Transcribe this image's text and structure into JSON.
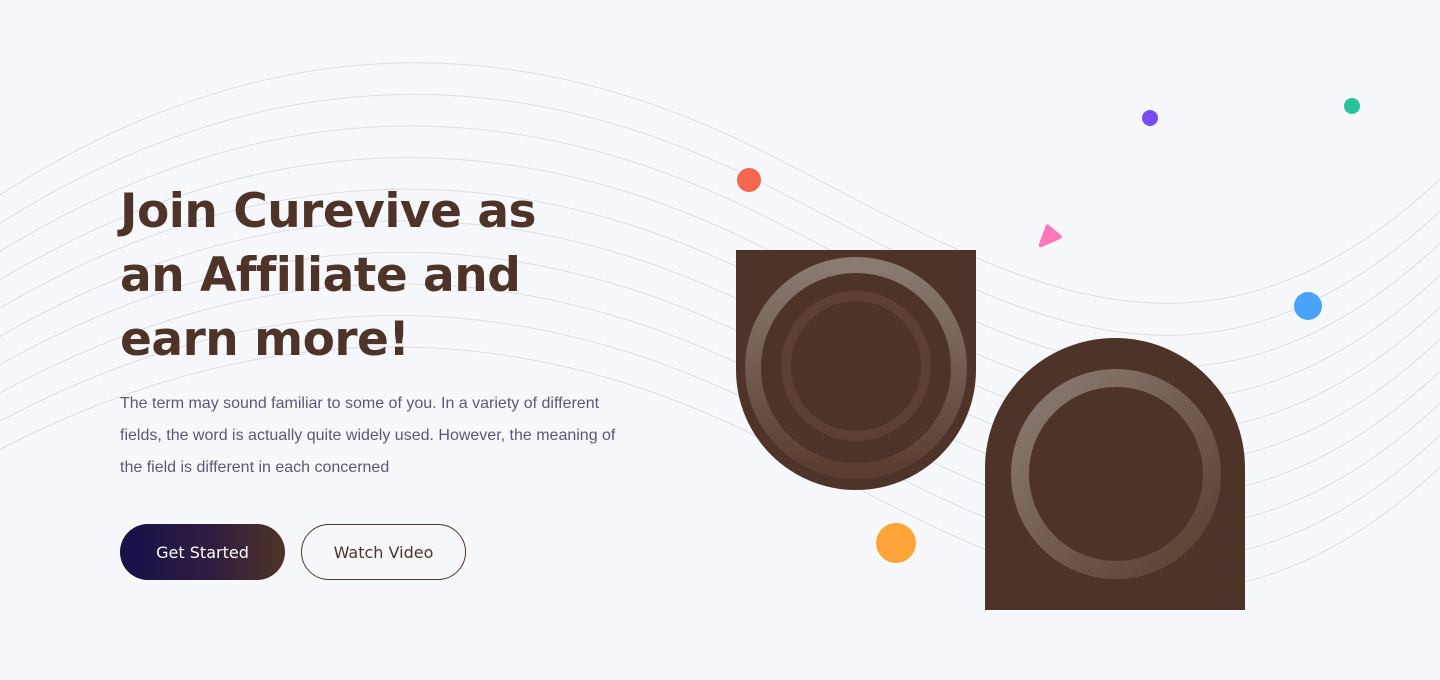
{
  "hero": {
    "title": "Join Curevive as an Affiliate and earn more!",
    "description": "The term may sound familiar to some of you. In a variety of different fields, the word is actually quite widely used. However, the meaning of the field is different in each concerned",
    "primary_button": "Get Started",
    "secondary_button": "Watch Video"
  },
  "colors": {
    "background": "#f7f8fb",
    "heading": "#4e3328",
    "body_text": "#5b5876",
    "brand_brown": "#4e3328",
    "brand_navy": "#15104b"
  },
  "decorations": {
    "dot_colors": [
      "#f4664e",
      "#7b4cf2",
      "#27c29a",
      "#4aa3fb",
      "#ffa53a"
    ],
    "triangle_color": "#ff79b8"
  }
}
